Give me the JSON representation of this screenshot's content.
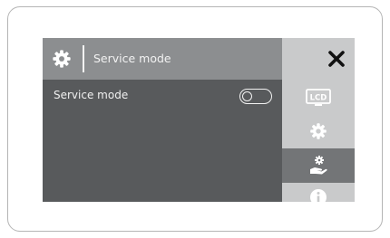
{
  "header": {
    "title": "Service mode",
    "icon": "gear-icon"
  },
  "content": {
    "row_label": "Service mode",
    "toggle_on": false
  },
  "sidebar": {
    "close_icon": "close-icon",
    "lcd_label": "LCD",
    "items": [
      "lcd-icon",
      "gear-icon",
      "service-hand-icon",
      "info-icon"
    ],
    "active_item": "service-hand-icon"
  },
  "colors": {
    "screen_bg": "#585a5c",
    "header_bg": "#8c8e90",
    "sidebar_bg": "#c9cacb",
    "active_bg": "#737577",
    "icon": "#ffffff"
  }
}
